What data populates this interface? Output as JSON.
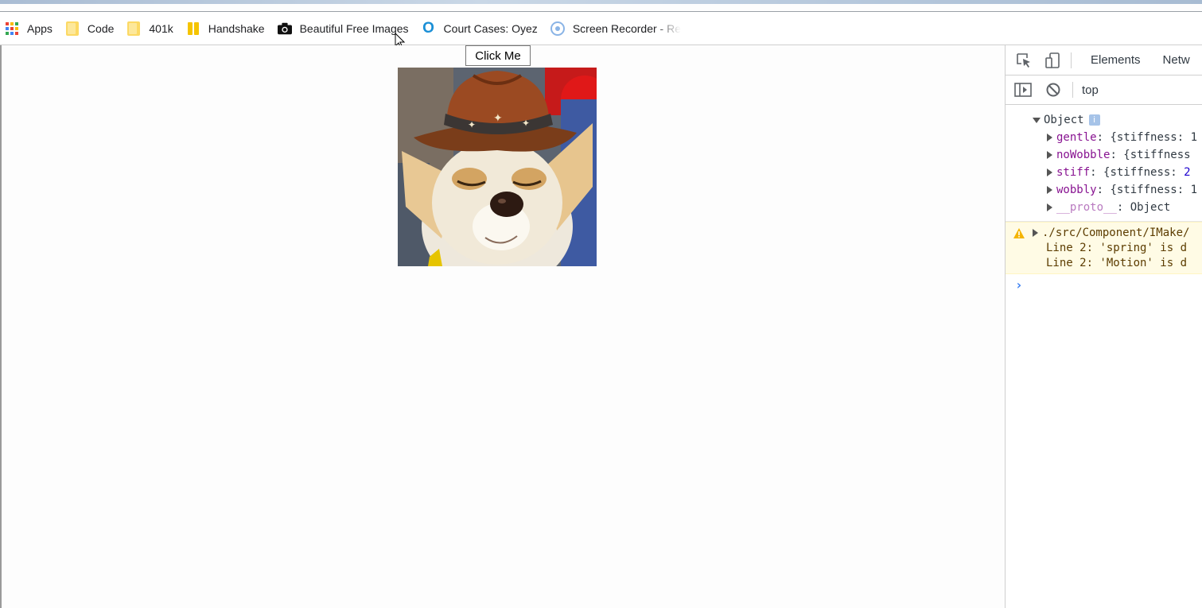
{
  "bookmarks": [
    {
      "label": "Apps",
      "icon": "apps-grid-icon"
    },
    {
      "label": "Code",
      "icon": "folder-icon"
    },
    {
      "label": "401k",
      "icon": "folder-icon"
    },
    {
      "label": "Handshake",
      "icon": "handshake-icon"
    },
    {
      "label": "Beautiful Free Images",
      "icon": "camera-icon"
    },
    {
      "label": "Court Cases: Oyez",
      "icon": "oyez-icon"
    },
    {
      "label": "Screen Recorder - Re",
      "icon": "screen-recorder-icon"
    }
  ],
  "page": {
    "button_label": "Click Me",
    "image_alt": "Chihuahua wearing a cowboy hat"
  },
  "devtools": {
    "tabs": [
      "Elements",
      "Netw"
    ],
    "context": "top",
    "console": {
      "object_label": "Object",
      "info_badge": "i",
      "props": [
        {
          "key": "gentle",
          "preview": "{stiffness: 1"
        },
        {
          "key": "noWobble",
          "preview": "{stiffness"
        },
        {
          "key": "stiff",
          "preview": "{stiffness: 2",
          "num": "2"
        },
        {
          "key": "wobbly",
          "preview": "{stiffness: 1"
        }
      ],
      "proto_key": "__proto__",
      "proto_value": "Object",
      "warning_path": "./src/Component/IMake/",
      "warning_lines": [
        "Line 2:  'spring' is d",
        "Line 2:  'Motion' is d"
      ],
      "prompt": "›"
    }
  },
  "colors": {
    "accent": "#1a73e8",
    "warning_bg": "#fffbe5",
    "property": "#881391"
  }
}
